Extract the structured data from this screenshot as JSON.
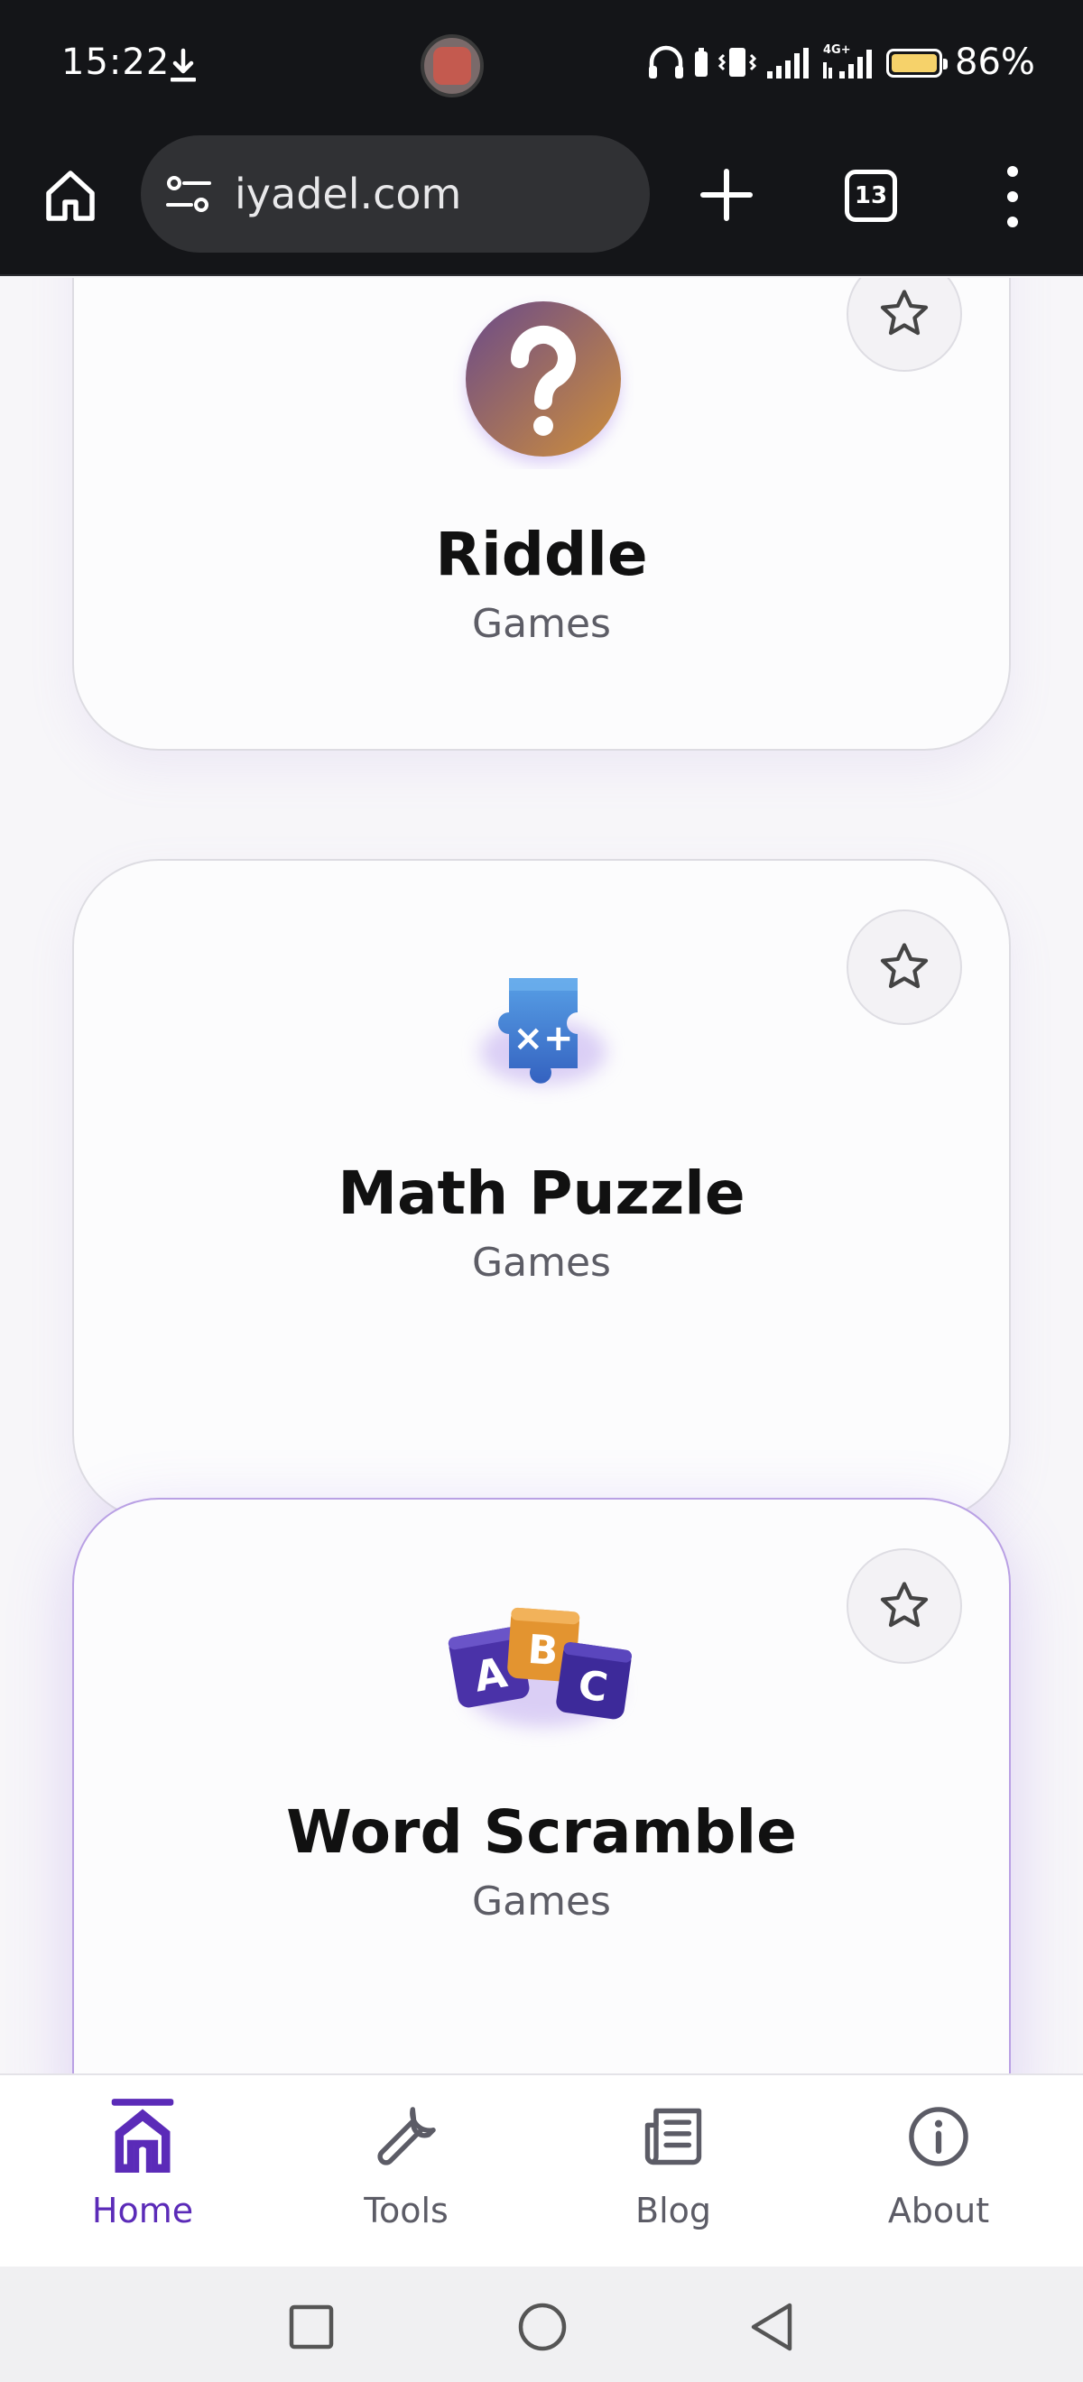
{
  "status_bar": {
    "time": "15:22",
    "battery_pct": "86%",
    "battery_level": 0.86,
    "network": "4G+"
  },
  "browser": {
    "url": "iyadel.com",
    "tab_count": "13"
  },
  "cards": [
    {
      "title": "Riddle",
      "category": "Games",
      "icon": "question-mark-icon"
    },
    {
      "title": "Math Puzzle",
      "category": "Games",
      "icon": "puzzle-piece-icon"
    },
    {
      "title": "Word Scramble",
      "category": "Games",
      "icon": "abc-blocks-icon"
    }
  ],
  "bottom_nav": {
    "items": [
      {
        "label": "Home",
        "icon": "home-icon",
        "active": true
      },
      {
        "label": "Tools",
        "icon": "wrench-icon",
        "active": false
      },
      {
        "label": "Blog",
        "icon": "newspaper-icon",
        "active": false
      },
      {
        "label": "About",
        "icon": "info-icon",
        "active": false
      }
    ]
  },
  "colors": {
    "accent": "#5b2bb8",
    "highlight_border": "#b9a0e4",
    "riddle_gradient_start": "#6a4a8a",
    "riddle_gradient_end": "#c88a3e",
    "puzzle_blue": "#3f7bd0",
    "block_orange": "#e0932e",
    "block_purple": "#4a2fa8"
  }
}
